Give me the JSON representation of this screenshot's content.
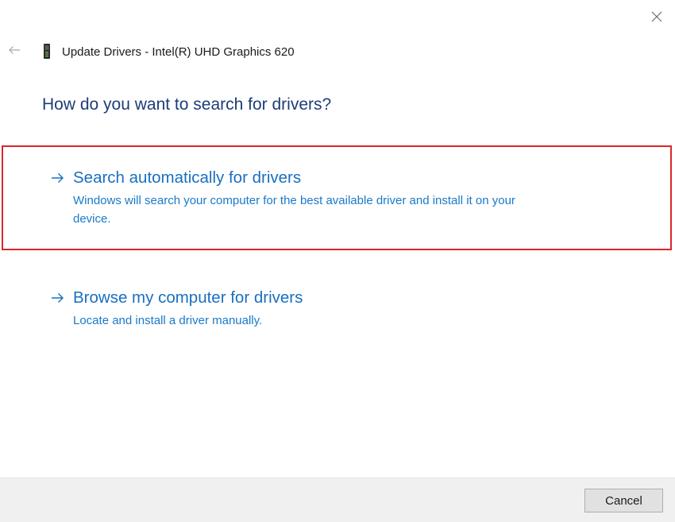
{
  "window": {
    "title": "Update Drivers - Intel(R) UHD Graphics 620",
    "title_icon": "display-adapter-icon",
    "back_icon": "back-arrow-icon",
    "close_icon": "close-icon"
  },
  "main": {
    "heading": "How do you want to search for drivers?",
    "options": [
      {
        "title": "Search automatically for drivers",
        "description": "Windows will search your computer for the best available driver and install it on your device.",
        "icon": "arrow-right-icon",
        "highlighted": true
      },
      {
        "title": "Browse my computer for drivers",
        "description": "Locate and install a driver manually.",
        "icon": "arrow-right-icon",
        "highlighted": false
      }
    ]
  },
  "footer": {
    "cancel_label": "Cancel"
  },
  "colors": {
    "heading": "#1e3c78",
    "link": "#1a6fc0",
    "highlight_border": "#d9262b",
    "footer_bg": "#f0f0f0"
  }
}
